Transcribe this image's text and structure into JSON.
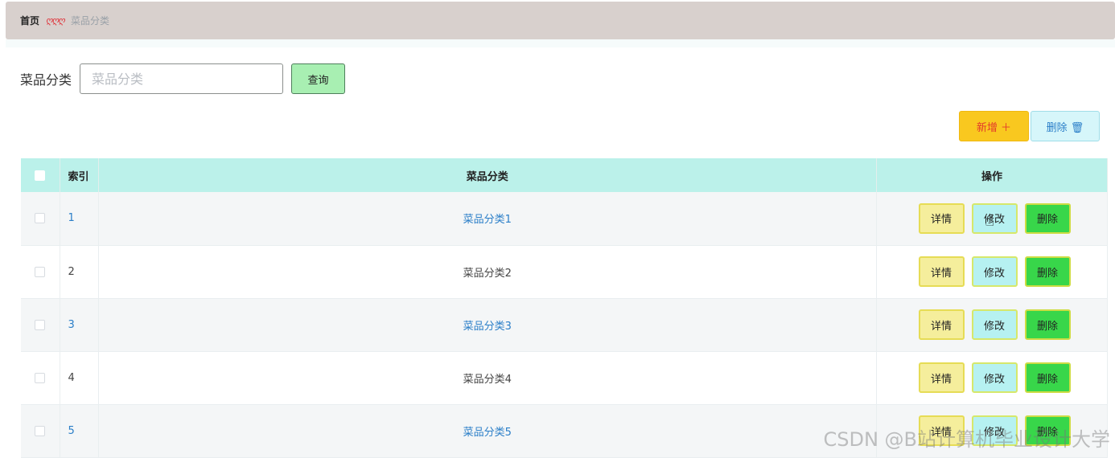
{
  "breadcrumb": {
    "home": "首页",
    "separator": "ღღღ",
    "current": "菜品分类"
  },
  "search": {
    "label": "菜品分类",
    "placeholder": "菜品分类",
    "value": "",
    "query_label": "查询"
  },
  "actions": {
    "add_label": "新增 ＋",
    "delete_label": "删除 🗑"
  },
  "table": {
    "headers": {
      "index": "索引",
      "name": "菜品分类",
      "ops": "操作"
    },
    "rows": [
      {
        "index": "1",
        "name": "菜品分类1",
        "link": true
      },
      {
        "index": "2",
        "name": "菜品分类2",
        "link": false
      },
      {
        "index": "3",
        "name": "菜品分类3",
        "link": true
      },
      {
        "index": "4",
        "name": "菜品分类4",
        "link": false
      },
      {
        "index": "5",
        "name": "菜品分类5",
        "link": true
      }
    ],
    "op_labels": {
      "detail": "详情",
      "edit": "修改",
      "delete": "删除"
    }
  },
  "watermark": "CSDN @B站计算机毕业设计大学",
  "colors": {
    "breadcrumb_bg": "#d8d0cd",
    "header_bg": "#bbf1ea",
    "query_btn": "#a8efb2",
    "add_btn": "#f9c81f",
    "detail_btn": "#f5ee9c",
    "edit_btn": "#b6f1f1",
    "delete_btn": "#38d64a",
    "link": "#2a7ec8"
  }
}
